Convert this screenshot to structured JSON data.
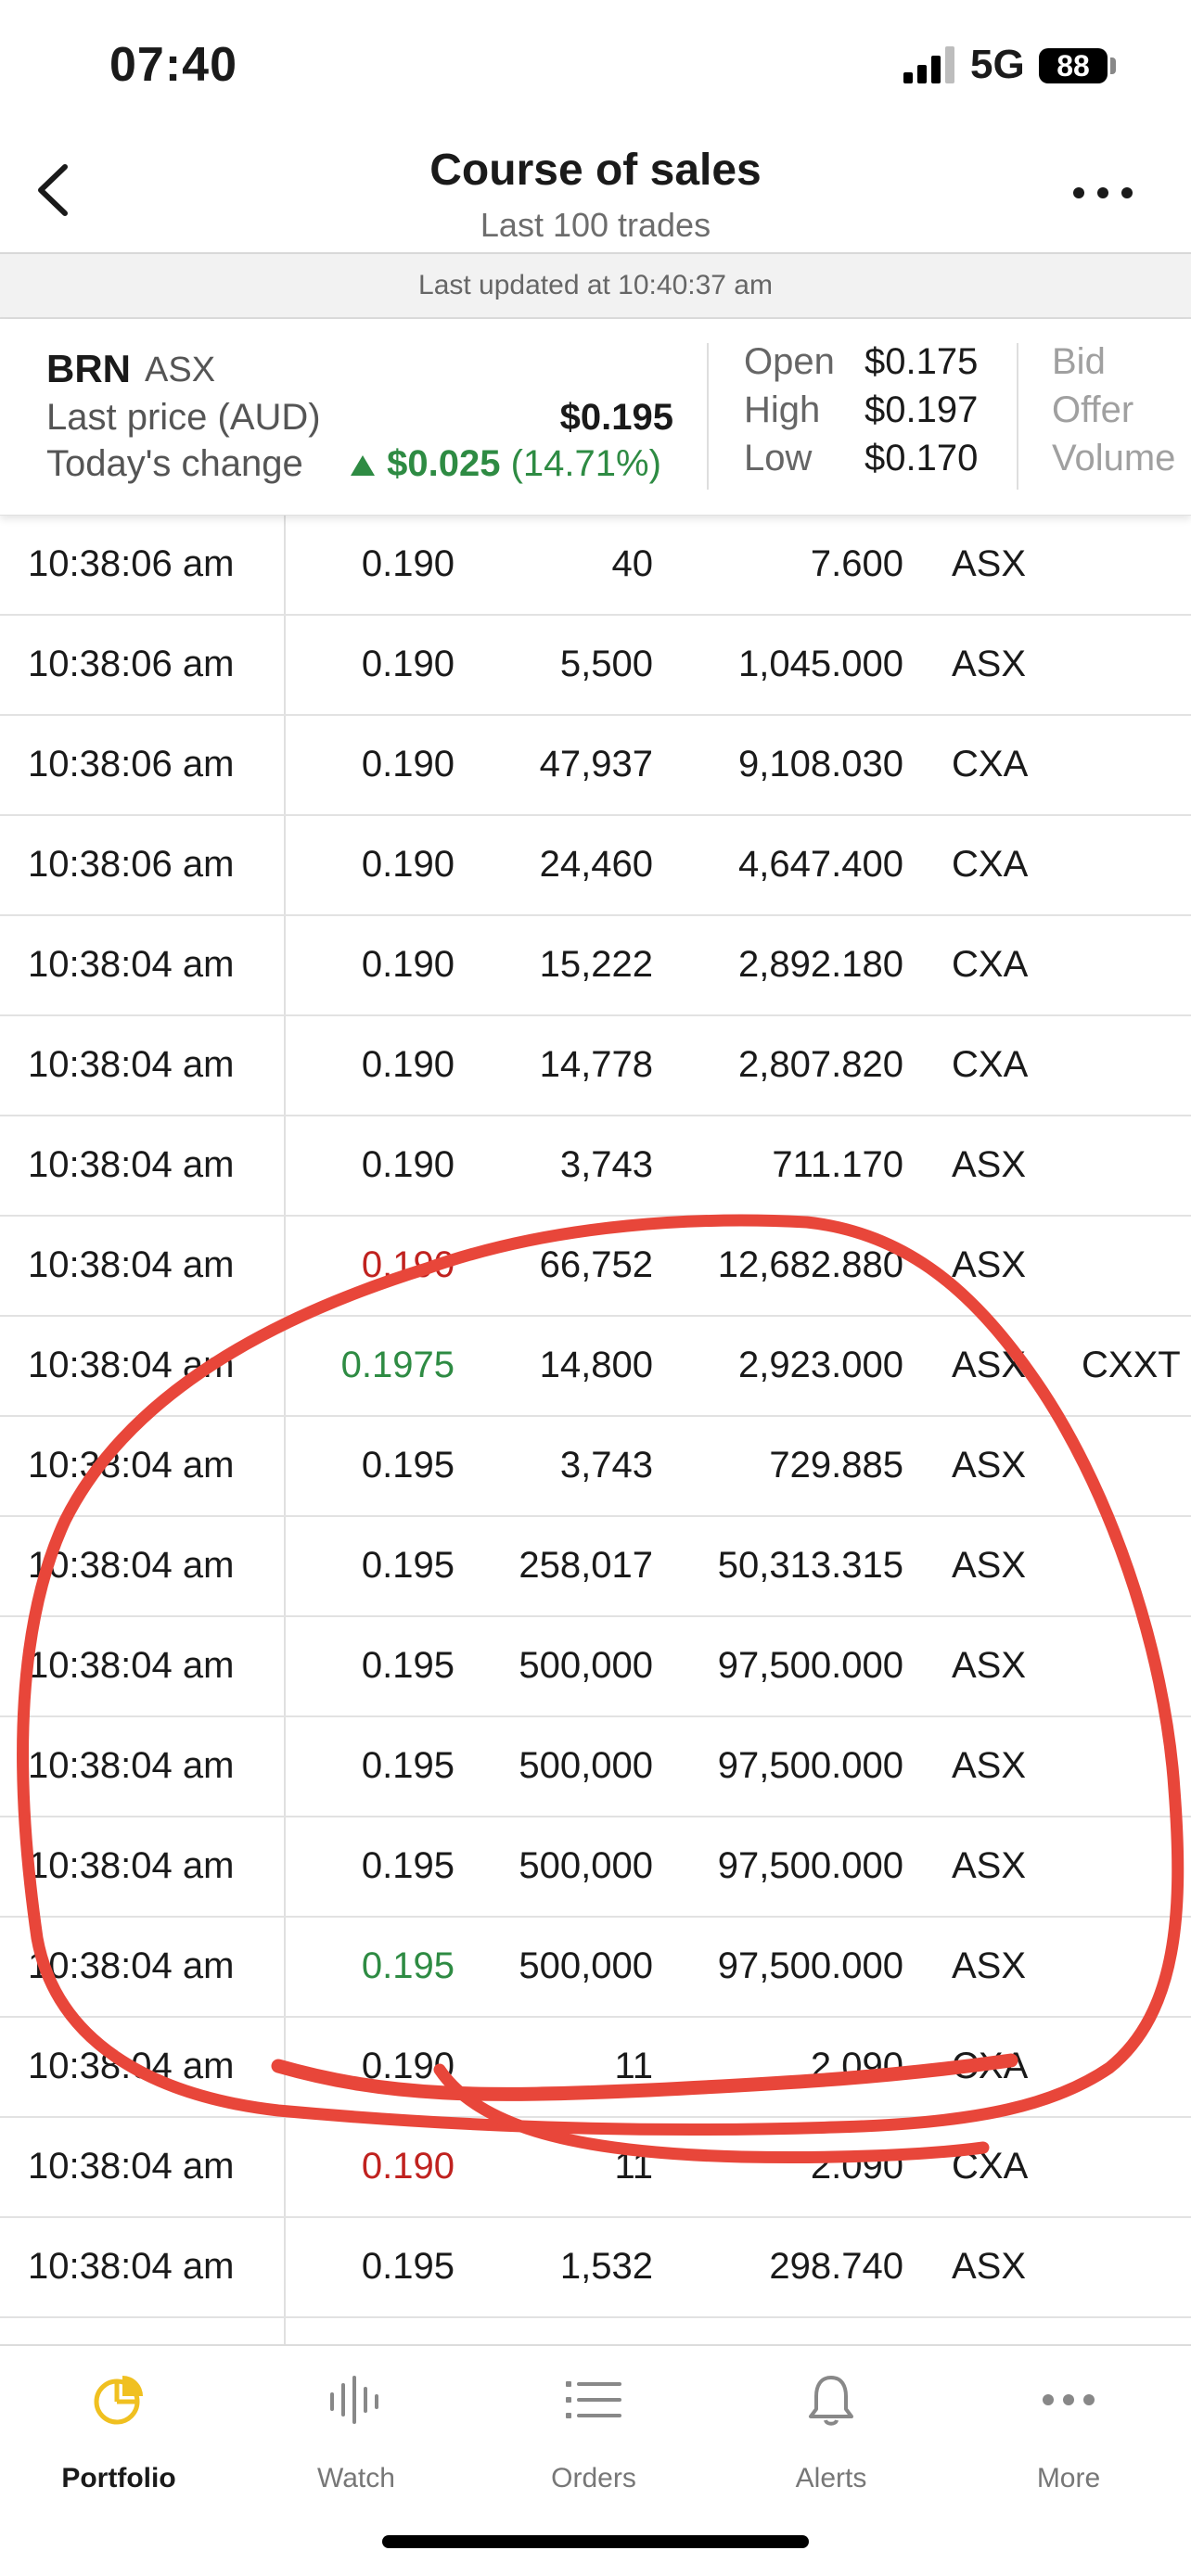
{
  "status_bar": {
    "time": "07:40",
    "network": "5G",
    "battery": "88"
  },
  "header": {
    "title": "Course of sales",
    "subtitle": "Last 100 trades"
  },
  "updated_text": "Last updated at 10:40:37 am",
  "quote": {
    "code": "BRN",
    "exchange": "ASX",
    "last_price_label": "Last price (AUD)",
    "last_price": "$0.195",
    "change_label": "Today's change",
    "change_value": "$0.025",
    "change_pct": "(14.71%)",
    "open_label": "Open",
    "open": "$0.175",
    "high_label": "High",
    "high": "$0.197",
    "low_label": "Low",
    "low": "$0.170",
    "bid_label": "Bid",
    "offer_label": "Offer",
    "volume_label": "Volume"
  },
  "trades": [
    {
      "time": "10:38:06 am",
      "price": "0.190",
      "volume": "40",
      "value": "7.600",
      "exchange": "ASX",
      "condition": "",
      "trend": ""
    },
    {
      "time": "10:38:06 am",
      "price": "0.190",
      "volume": "5,500",
      "value": "1,045.000",
      "exchange": "ASX",
      "condition": "",
      "trend": ""
    },
    {
      "time": "10:38:06 am",
      "price": "0.190",
      "volume": "47,937",
      "value": "9,108.030",
      "exchange": "CXA",
      "condition": "",
      "trend": ""
    },
    {
      "time": "10:38:06 am",
      "price": "0.190",
      "volume": "24,460",
      "value": "4,647.400",
      "exchange": "CXA",
      "condition": "",
      "trend": ""
    },
    {
      "time": "10:38:04 am",
      "price": "0.190",
      "volume": "15,222",
      "value": "2,892.180",
      "exchange": "CXA",
      "condition": "",
      "trend": ""
    },
    {
      "time": "10:38:04 am",
      "price": "0.190",
      "volume": "14,778",
      "value": "2,807.820",
      "exchange": "CXA",
      "condition": "",
      "trend": ""
    },
    {
      "time": "10:38:04 am",
      "price": "0.190",
      "volume": "3,743",
      "value": "711.170",
      "exchange": "ASX",
      "condition": "",
      "trend": ""
    },
    {
      "time": "10:38:04 am",
      "price": "0.190",
      "volume": "66,752",
      "value": "12,682.880",
      "exchange": "ASX",
      "condition": "",
      "trend": "down"
    },
    {
      "time": "10:38:04 am",
      "price": "0.1975",
      "volume": "14,800",
      "value": "2,923.000",
      "exchange": "ASX",
      "condition": "CXXT",
      "trend": "up"
    },
    {
      "time": "10:38:04 am",
      "price": "0.195",
      "volume": "3,743",
      "value": "729.885",
      "exchange": "ASX",
      "condition": "",
      "trend": ""
    },
    {
      "time": "10:38:04 am",
      "price": "0.195",
      "volume": "258,017",
      "value": "50,313.315",
      "exchange": "ASX",
      "condition": "",
      "trend": ""
    },
    {
      "time": "10:38:04 am",
      "price": "0.195",
      "volume": "500,000",
      "value": "97,500.000",
      "exchange": "ASX",
      "condition": "",
      "trend": ""
    },
    {
      "time": "10:38:04 am",
      "price": "0.195",
      "volume": "500,000",
      "value": "97,500.000",
      "exchange": "ASX",
      "condition": "",
      "trend": ""
    },
    {
      "time": "10:38:04 am",
      "price": "0.195",
      "volume": "500,000",
      "value": "97,500.000",
      "exchange": "ASX",
      "condition": "",
      "trend": ""
    },
    {
      "time": "10:38:04 am",
      "price": "0.195",
      "volume": "500,000",
      "value": "97,500.000",
      "exchange": "ASX",
      "condition": "",
      "trend": "up"
    },
    {
      "time": "10:38:04 am",
      "price": "0.190",
      "volume": "11",
      "value": "2.090",
      "exchange": "CXA",
      "condition": "",
      "trend": ""
    },
    {
      "time": "10:38:04 am",
      "price": "0.190",
      "volume": "11",
      "value": "2.090",
      "exchange": "CXA",
      "condition": "",
      "trend": "down"
    },
    {
      "time": "10:38:04 am",
      "price": "0.195",
      "volume": "1,532",
      "value": "298.740",
      "exchange": "ASX",
      "condition": "",
      "trend": ""
    }
  ],
  "tabs": [
    {
      "label": "Portfolio",
      "icon": "pie-chart-icon",
      "active": true
    },
    {
      "label": "Watch",
      "icon": "waveform-icon",
      "active": false
    },
    {
      "label": "Orders",
      "icon": "list-icon",
      "active": false
    },
    {
      "label": "Alerts",
      "icon": "bell-icon",
      "active": false
    },
    {
      "label": "More",
      "icon": "ellipsis-icon",
      "active": false
    }
  ],
  "colors": {
    "accent_tab": "#f0c020",
    "up": "#2e8b43",
    "down": "#c0221f",
    "annotation": "#e8463a"
  }
}
